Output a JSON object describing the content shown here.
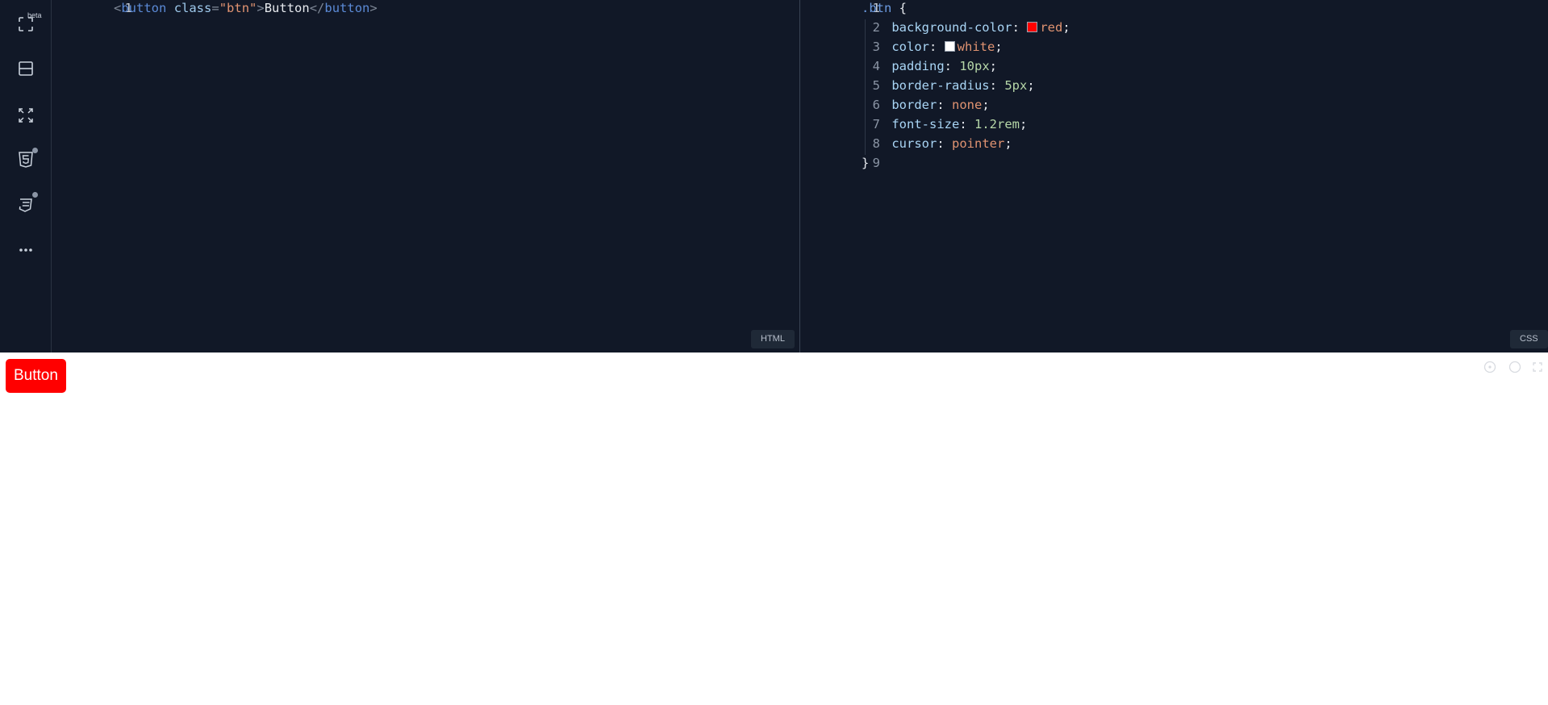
{
  "sidebar": {
    "beta_label": "beta",
    "items": [
      {
        "icon": "focus-frame-icon"
      },
      {
        "icon": "split-layout-icon"
      },
      {
        "icon": "expand-arrows-icon"
      },
      {
        "icon": "html5-icon"
      },
      {
        "icon": "css3-icon"
      },
      {
        "icon": "more-dots-icon"
      }
    ]
  },
  "html_editor": {
    "language_label": "HTML",
    "lines": [
      {
        "number": "1",
        "tokens": [
          {
            "text": "<",
            "type": "punct"
          },
          {
            "text": "button",
            "type": "tag"
          },
          {
            "text": " ",
            "type": "text"
          },
          {
            "text": "class",
            "type": "attr"
          },
          {
            "text": "=",
            "type": "punct"
          },
          {
            "text": "\"btn\"",
            "type": "str"
          },
          {
            "text": ">",
            "type": "punct"
          },
          {
            "text": "Button",
            "type": "text"
          },
          {
            "text": "</",
            "type": "punct"
          },
          {
            "text": "button",
            "type": "tag"
          },
          {
            "text": ">",
            "type": "punct"
          }
        ]
      }
    ]
  },
  "css_editor": {
    "language_label": "CSS",
    "lines": [
      {
        "number": "1",
        "tokens": [
          {
            "text": ".btn",
            "type": "sel"
          },
          {
            "text": " {",
            "type": "brace"
          }
        ]
      },
      {
        "number": "2",
        "tokens": [
          {
            "text": "    background-color",
            "type": "prop"
          },
          {
            "text": ": ",
            "type": "text"
          },
          {
            "text": "",
            "type": "swatch",
            "color": "#ff0000"
          },
          {
            "text": "red",
            "type": "val"
          },
          {
            "text": ";",
            "type": "text"
          }
        ]
      },
      {
        "number": "3",
        "tokens": [
          {
            "text": "    color",
            "type": "prop"
          },
          {
            "text": ": ",
            "type": "text"
          },
          {
            "text": "",
            "type": "swatch",
            "color": "#ffffff"
          },
          {
            "text": "white",
            "type": "val"
          },
          {
            "text": ";",
            "type": "text"
          }
        ]
      },
      {
        "number": "4",
        "tokens": [
          {
            "text": "    padding",
            "type": "prop"
          },
          {
            "text": ": ",
            "type": "text"
          },
          {
            "text": "10px",
            "type": "num"
          },
          {
            "text": ";",
            "type": "text"
          }
        ]
      },
      {
        "number": "5",
        "tokens": [
          {
            "text": "    border-radius",
            "type": "prop"
          },
          {
            "text": ": ",
            "type": "text"
          },
          {
            "text": "5px",
            "type": "num"
          },
          {
            "text": ";",
            "type": "text"
          }
        ]
      },
      {
        "number": "6",
        "tokens": [
          {
            "text": "    border",
            "type": "prop"
          },
          {
            "text": ": ",
            "type": "text"
          },
          {
            "text": "none",
            "type": "val"
          },
          {
            "text": ";",
            "type": "text"
          }
        ]
      },
      {
        "number": "7",
        "tokens": [
          {
            "text": "    font-size",
            "type": "prop"
          },
          {
            "text": ": ",
            "type": "text"
          },
          {
            "text": "1.2rem",
            "type": "num"
          },
          {
            "text": ";",
            "type": "text"
          }
        ]
      },
      {
        "number": "8",
        "tokens": [
          {
            "text": "    cursor",
            "type": "prop"
          },
          {
            "text": ": ",
            "type": "text"
          },
          {
            "text": "pointer",
            "type": "val"
          },
          {
            "text": ";",
            "type": "text"
          }
        ]
      },
      {
        "number": "9",
        "tokens": [
          {
            "text": "}",
            "type": "brace"
          }
        ]
      }
    ]
  },
  "preview": {
    "button_label": "Button",
    "icons": [
      "target-icon",
      "circle-icon",
      "fullscreen-icon"
    ]
  },
  "colors": {
    "editor_bg": "#111827",
    "preview_button_bg": "#ff0000",
    "preview_button_text": "#ffffff"
  }
}
